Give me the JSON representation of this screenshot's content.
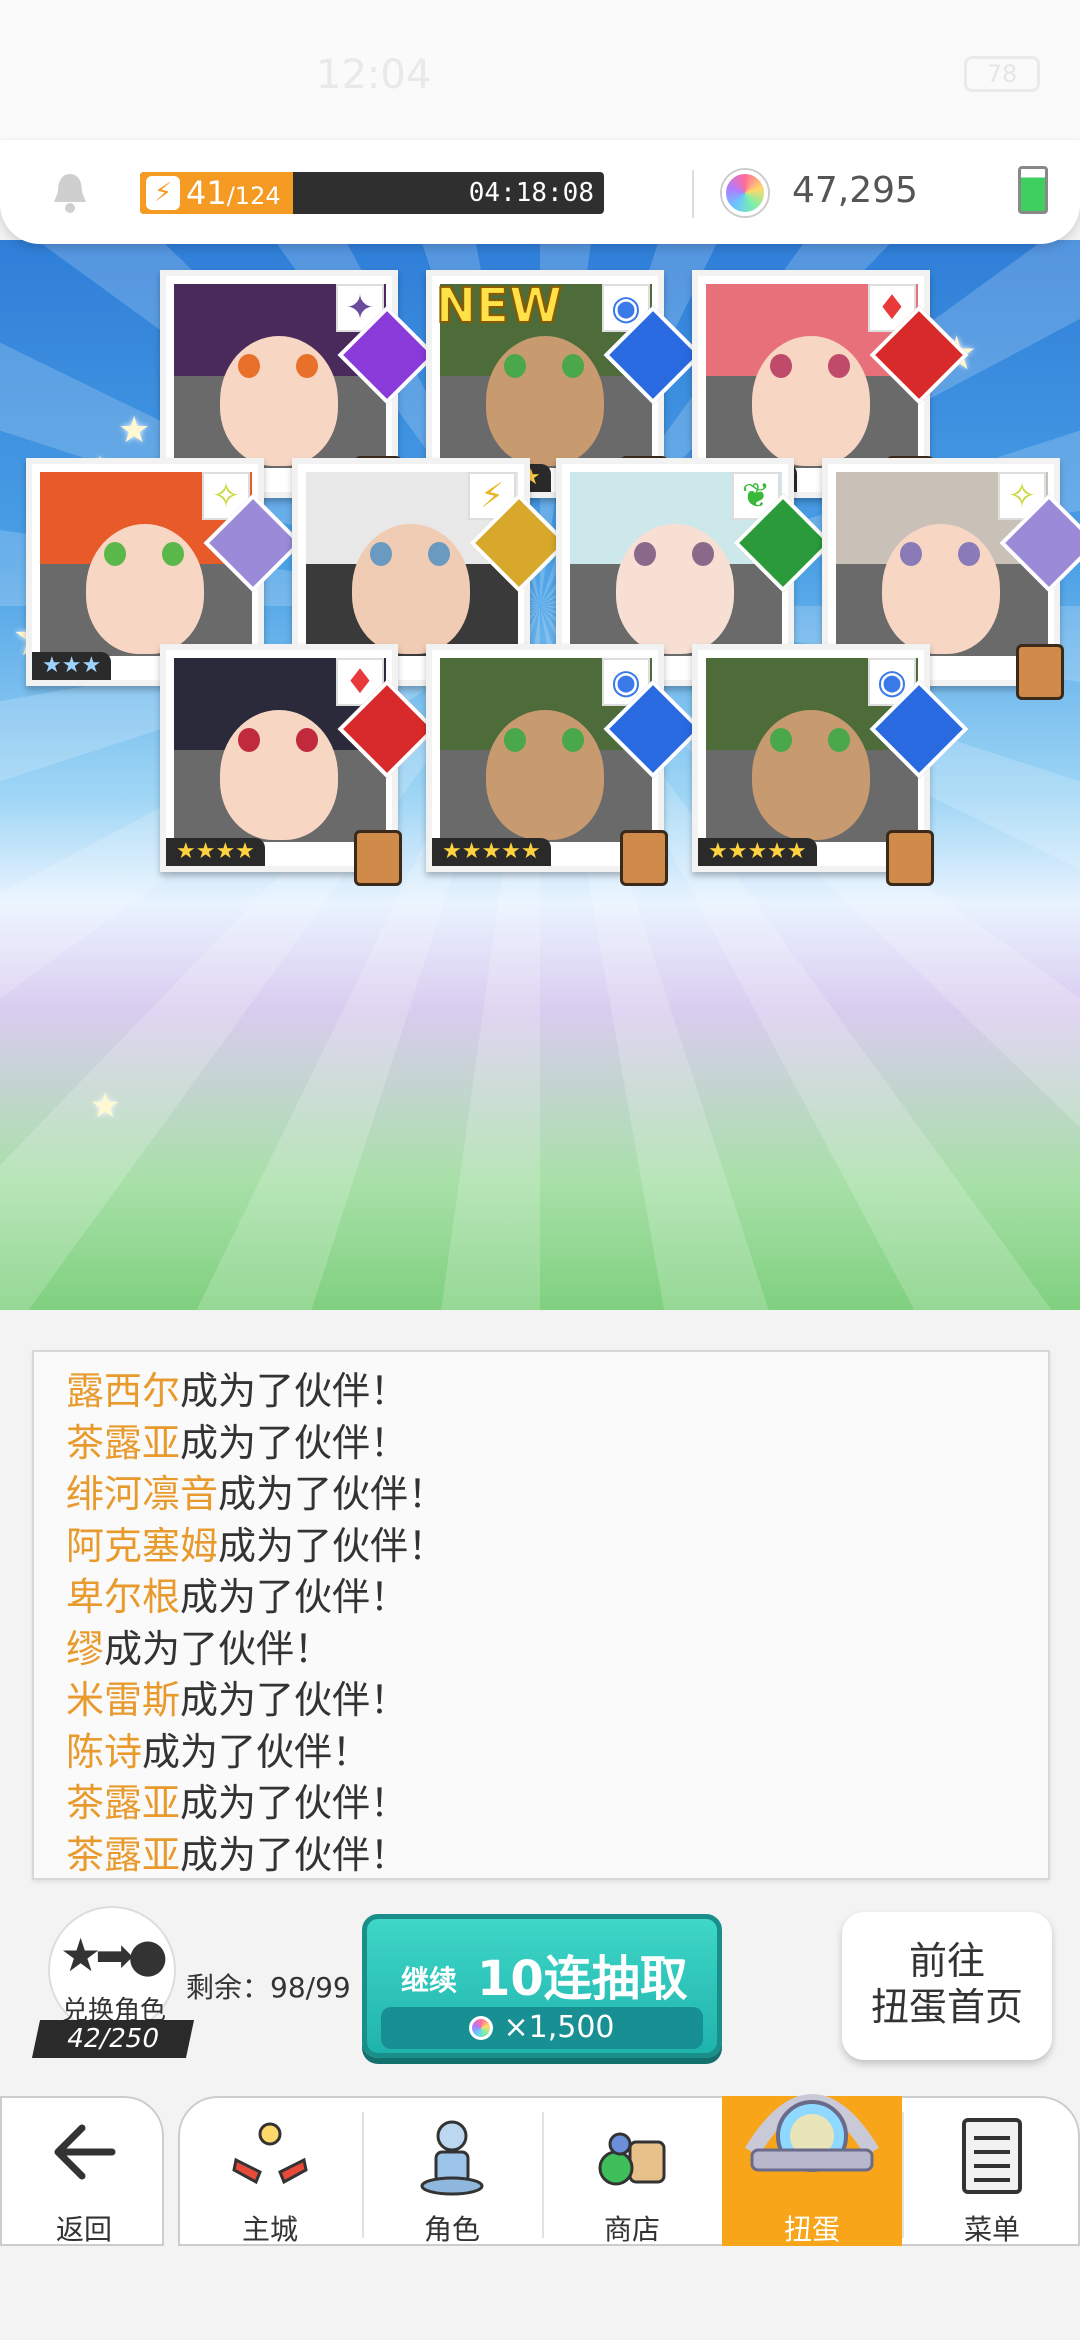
{
  "status": {
    "time": "12:04",
    "battery": "78"
  },
  "resources": {
    "stamina_current": "41",
    "stamina_max": "/124",
    "stamina_fraction": 0.33,
    "stamina_timer": "04:18:08",
    "gems": "47,295"
  },
  "cards": [
    {
      "stars": "★★★",
      "rarity": 3,
      "element": "dark-diamond-icon",
      "new": false
    },
    {
      "stars": "★★★★★",
      "rarity": 5,
      "element": "water-circle-icon",
      "new": true,
      "new_label": "NEW"
    },
    {
      "stars": "★★★★",
      "rarity": 4,
      "element": "fire-diamonds-icon",
      "new": false
    },
    {
      "stars": "★★★",
      "rarity": 3,
      "element": "light-star-icon",
      "new": false
    },
    {
      "stars": "★★★",
      "rarity": 3,
      "element": "thunder-bolt-icon",
      "new": false
    },
    {
      "stars": "★★★",
      "rarity": 3,
      "element": "wind-leaf-icon",
      "new": false
    },
    {
      "stars": "★★★",
      "rarity": 3,
      "element": "light-star-icon",
      "new": false
    },
    {
      "stars": "★★★★",
      "rarity": 4,
      "element": "fire-diamonds-icon",
      "new": false
    },
    {
      "stars": "★★★★★",
      "rarity": 5,
      "element": "water-circle-icon",
      "new": false
    },
    {
      "stars": "★★★★★",
      "rarity": 5,
      "element": "water-circle-icon",
      "new": false
    }
  ],
  "log": [
    {
      "name": "露西尔",
      "text": "成为了伙伴！"
    },
    {
      "name": "茶露亚",
      "text": "成为了伙伴！"
    },
    {
      "name": "绯河凛音",
      "text": "成为了伙伴！"
    },
    {
      "name": "阿克塞姆",
      "text": "成为了伙伴！"
    },
    {
      "name": "卑尔根",
      "text": "成为了伙伴！"
    },
    {
      "name": "缪",
      "text": "成为了伙伴！"
    },
    {
      "name": "米雷斯",
      "text": "成为了伙伴！"
    },
    {
      "name": "陈诗",
      "text": "成为了伙伴！"
    },
    {
      "name": "茶露亚",
      "text": "成为了伙伴！"
    },
    {
      "name": "茶露亚",
      "text": "成为了伙伴！"
    }
  ],
  "exchange": {
    "label": "兑换角色",
    "count": "42/250",
    "remain": "剩余：98/99"
  },
  "draw_button": {
    "continue_label": "继续",
    "main_label": "10连抽取",
    "cost": "×1,500"
  },
  "go_home": {
    "line1": "前往",
    "line2": "扭蛋首页"
  },
  "nav": {
    "back": "返回",
    "tabs": [
      "主城",
      "角色",
      "商店",
      "扭蛋",
      "菜单"
    ],
    "active": "扭蛋"
  },
  "colors": {
    "accent": "#26c0b0",
    "stamina": "#f59a23",
    "name_highlight": "#e89a2c",
    "active_tab": "#f9a51a"
  }
}
